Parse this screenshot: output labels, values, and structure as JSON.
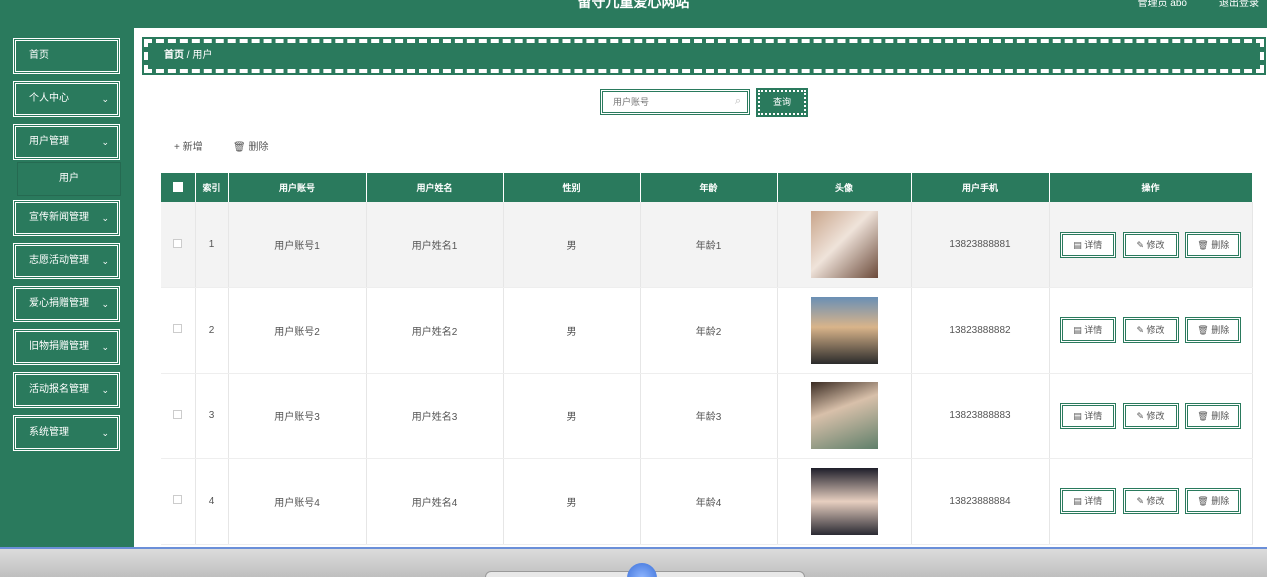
{
  "header": {
    "title": "留守儿童爱心网站",
    "admin": "管理员 abo",
    "logout": "退出登录"
  },
  "sidebar": {
    "items": [
      {
        "label": "首页",
        "chevron": false
      },
      {
        "label": "个人中心",
        "chevron": true
      },
      {
        "label": "用户管理",
        "chevron": true
      },
      {
        "label": "宣传新闻管理",
        "chevron": true
      },
      {
        "label": "志愿活动管理",
        "chevron": true
      },
      {
        "label": "爱心捐赠管理",
        "chevron": true
      },
      {
        "label": "旧物捐赠管理",
        "chevron": true
      },
      {
        "label": "活动报名管理",
        "chevron": true
      },
      {
        "label": "系统管理",
        "chevron": true
      }
    ],
    "submenu": "用户"
  },
  "breadcrumb": {
    "home": "首页",
    "sep": "/",
    "current": "用户"
  },
  "search": {
    "placeholder": "用户账号",
    "button": "查询"
  },
  "actions": {
    "add": "+ 新增",
    "delete": "删除"
  },
  "table": {
    "headers": [
      "索引",
      "用户账号",
      "用户姓名",
      "性别",
      "年龄",
      "头像",
      "用户手机",
      "操作"
    ],
    "rows": [
      {
        "index": "1",
        "account": "用户账号1",
        "name": "用户姓名1",
        "gender": "男",
        "age": "年龄1",
        "phone": "13823888881"
      },
      {
        "index": "2",
        "account": "用户账号2",
        "name": "用户姓名2",
        "gender": "男",
        "age": "年龄2",
        "phone": "13823888882"
      },
      {
        "index": "3",
        "account": "用户账号3",
        "name": "用户姓名3",
        "gender": "男",
        "age": "年龄3",
        "phone": "13823888883"
      },
      {
        "index": "4",
        "account": "用户账号4",
        "name": "用户姓名4",
        "gender": "男",
        "age": "年龄4",
        "phone": "13823888884"
      }
    ],
    "ops": {
      "detail": "详情",
      "edit": "修改",
      "delete": "删除"
    }
  },
  "colors": {
    "primary": "#2a7a5d"
  }
}
